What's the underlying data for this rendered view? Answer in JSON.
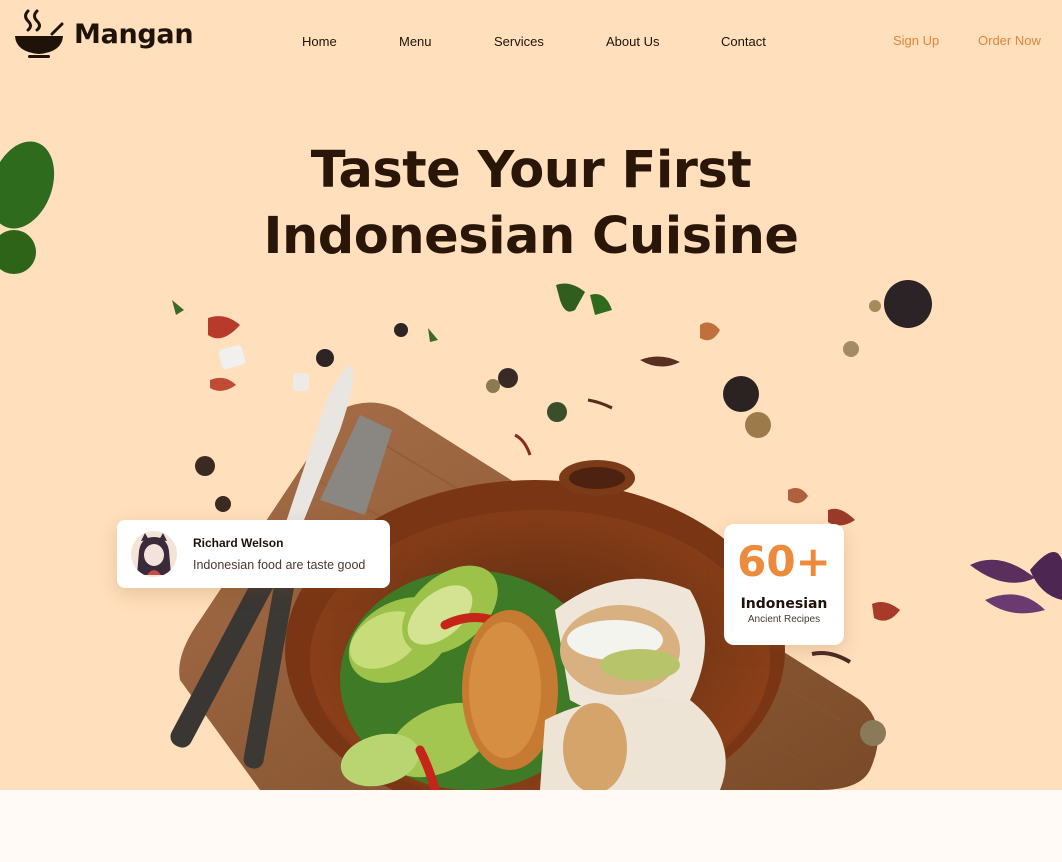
{
  "brand": {
    "name": "Mangan",
    "icon": "bowl-steam-icon"
  },
  "nav": {
    "items": [
      {
        "label": "Home"
      },
      {
        "label": "Menu"
      },
      {
        "label": "Services"
      },
      {
        "label": "About Us"
      },
      {
        "label": "Contact"
      }
    ]
  },
  "auth": {
    "signup_label": "Sign Up",
    "order_label": "Order Now"
  },
  "hero": {
    "headline_line1": "Taste Your First",
    "headline_line2": "Indonesian Cuisine"
  },
  "review": {
    "name": "Richard Welson",
    "quote": "Indonesian food are taste good"
  },
  "stats": {
    "value": "60+",
    "title": "Indonesian",
    "subtitle": "Ancient Recipes"
  },
  "colors": {
    "hero_bg": "#ffdfbc",
    "accent": "#ee8a3c",
    "text_dark": "#1f1209",
    "page_bg": "#fffaf5"
  }
}
